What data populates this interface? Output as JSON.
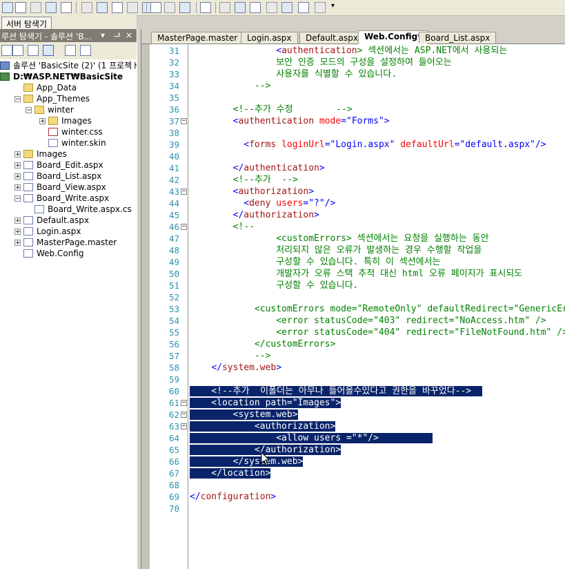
{
  "toolbar": {
    "icons": [
      "solution-explorer-icon",
      "properties-icon",
      "open-icon",
      "save-icon",
      "save-all-icon",
      "cut-icon",
      "copy-icon",
      "paste-icon",
      "undo-icon",
      "redo-icon",
      "indent-icon",
      "outdent-icon",
      "comment-icon",
      "uncomment-icon",
      "bookmark-icon",
      "prev-bookmark-icon",
      "next-bookmark-icon",
      "prev-bookmark-folder-icon",
      "next-bookmark-folder-icon",
      "clear-bookmarks-icon",
      "find-icon",
      "overflow-icon"
    ]
  },
  "server_tab": "서버 탐색기",
  "solution": {
    "title": "루션 탐색기 - 솔루션 'B...",
    "controls": [
      "▾",
      "ᅾ",
      "×"
    ],
    "tree": [
      {
        "label": "솔루션 'BasicSite (2)' (1 프로젝ト",
        "icon": "solution-icon",
        "level": 0
      },
      {
        "label": "D:₩ASP.NET₩BasicSite",
        "icon": "project-icon",
        "level": 0,
        "bold": true
      },
      {
        "label": "App_Data",
        "icon": "folder-icon",
        "level": 1
      },
      {
        "label": "App_Themes",
        "icon": "folder-icon",
        "level": 1,
        "expander": "−"
      },
      {
        "label": "winter",
        "icon": "folder-icon",
        "level": 2,
        "expander": "−"
      },
      {
        "label": "Images",
        "icon": "folder-icon",
        "level": 3,
        "expander": "+"
      },
      {
        "label": "winter.css",
        "icon": "css-file-icon",
        "level": 3
      },
      {
        "label": "winter.skin",
        "icon": "skin-file-icon",
        "level": 3
      },
      {
        "label": "Images",
        "icon": "folder-icon",
        "level": 1,
        "expander": "+"
      },
      {
        "label": "Board_Edit.aspx",
        "icon": "aspx-file-icon",
        "level": 1,
        "expander": "+"
      },
      {
        "label": "Board_List.aspx",
        "icon": "aspx-file-icon",
        "level": 1,
        "expander": "+"
      },
      {
        "label": "Board_View.aspx",
        "icon": "aspx-file-icon",
        "level": 1,
        "expander": "+"
      },
      {
        "label": "Board_Write.aspx",
        "icon": "aspx-file-icon",
        "level": 1,
        "expander": "−"
      },
      {
        "label": "Board_Write.aspx.cs",
        "icon": "cs-file-icon",
        "level": 2
      },
      {
        "label": "Default.aspx",
        "icon": "aspx-file-icon",
        "level": 1,
        "expander": "+"
      },
      {
        "label": "Login.aspx",
        "icon": "aspx-file-icon",
        "level": 1,
        "expander": "+"
      },
      {
        "label": "MasterPage.master",
        "icon": "master-file-icon",
        "level": 1,
        "expander": "+"
      },
      {
        "label": "Web.Config",
        "icon": "config-file-icon",
        "level": 1
      }
    ]
  },
  "tabs": [
    {
      "label": "MasterPage.master",
      "active": false
    },
    {
      "label": "Login.aspx",
      "active": false
    },
    {
      "label": "Default.aspx",
      "active": false
    },
    {
      "label": "Web.Config*",
      "active": true
    },
    {
      "label": "Board_List.aspx",
      "active": false
    }
  ],
  "editor": {
    "selection_color": "#0a246a",
    "fold_markers": {
      "37": "−",
      "43": "−",
      "46": "−",
      "61": "−",
      "62": "−",
      "63": "−"
    },
    "lines": [
      {
        "n": 31,
        "segs": [
          [
            "                ",
            ""
          ],
          [
            "<",
            "blue"
          ],
          [
            "authentication",
            "mar"
          ],
          [
            "> 섹션에서는 ASP.NET에서 사용되는",
            "green"
          ]
        ]
      },
      {
        "n": 32,
        "segs": [
          [
            "                보안 인증 모드의 구성을 설정하여 들어오는",
            "green"
          ]
        ]
      },
      {
        "n": 33,
        "segs": [
          [
            "                사용자를 식별할 수 있습니다.",
            "green"
          ]
        ]
      },
      {
        "n": 34,
        "segs": [
          [
            "            -->",
            "green"
          ]
        ]
      },
      {
        "n": 35,
        "segs": []
      },
      {
        "n": 36,
        "segs": [
          [
            "        ",
            ""
          ],
          [
            "<!--추가 수정        -->",
            "green"
          ]
        ]
      },
      {
        "n": 37,
        "segs": [
          [
            "        ",
            ""
          ],
          [
            "<",
            "blue"
          ],
          [
            "authentication",
            "mar"
          ],
          [
            " ",
            ""
          ],
          [
            "mode",
            "red"
          ],
          [
            "=\"",
            "blue"
          ],
          [
            "Forms",
            "blue"
          ],
          [
            "\">",
            "blue"
          ]
        ]
      },
      {
        "n": 38,
        "segs": []
      },
      {
        "n": 39,
        "segs": [
          [
            "          ",
            ""
          ],
          [
            "<",
            "blue"
          ],
          [
            "forms",
            "mar"
          ],
          [
            " ",
            ""
          ],
          [
            "loginUrl",
            "red"
          ],
          [
            "=\"Login.aspx\"",
            "blue"
          ],
          [
            " ",
            ""
          ],
          [
            "defaultUrl",
            "red"
          ],
          [
            "=\"default.aspx\"/>",
            "blue"
          ]
        ]
      },
      {
        "n": 40,
        "segs": []
      },
      {
        "n": 41,
        "segs": [
          [
            "        ",
            ""
          ],
          [
            "</",
            "blue"
          ],
          [
            "authentication",
            "mar"
          ],
          [
            ">",
            "blue"
          ]
        ]
      },
      {
        "n": 42,
        "segs": [
          [
            "        ",
            ""
          ],
          [
            "<!--추가  -->",
            "green"
          ]
        ]
      },
      {
        "n": 43,
        "segs": [
          [
            "        ",
            ""
          ],
          [
            "<",
            "blue"
          ],
          [
            "authorization",
            "mar"
          ],
          [
            ">",
            "blue"
          ]
        ]
      },
      {
        "n": 44,
        "segs": [
          [
            "          ",
            ""
          ],
          [
            "<",
            "blue"
          ],
          [
            "deny",
            "mar"
          ],
          [
            " ",
            ""
          ],
          [
            "users",
            "red"
          ],
          [
            "=\"?\"/>",
            "blue"
          ]
        ]
      },
      {
        "n": 45,
        "segs": [
          [
            "        ",
            ""
          ],
          [
            "</",
            "blue"
          ],
          [
            "authorization",
            "mar"
          ],
          [
            ">",
            "blue"
          ]
        ]
      },
      {
        "n": 46,
        "segs": [
          [
            "        ",
            ""
          ],
          [
            "<!--",
            "green"
          ]
        ]
      },
      {
        "n": 47,
        "segs": [
          [
            "                ",
            ""
          ],
          [
            "<customErrors> 섹션에서는 요청을 실행하는 동안",
            "green"
          ]
        ]
      },
      {
        "n": 48,
        "segs": [
          [
            "                처리되지 않은 오류가 발생하는 경우 수행할 작업을",
            "green"
          ]
        ]
      },
      {
        "n": 49,
        "segs": [
          [
            "                구성할 수 있습니다. 특히 이 섹션에서는",
            "green"
          ]
        ]
      },
      {
        "n": 50,
        "segs": [
          [
            "                개발자가 오류 스택 추적 대신 html 오류 페이지가 표시되도",
            "green"
          ]
        ]
      },
      {
        "n": 51,
        "segs": [
          [
            "                구성할 수 있습니다.",
            "green"
          ]
        ]
      },
      {
        "n": 52,
        "segs": []
      },
      {
        "n": 53,
        "segs": [
          [
            "            <customErrors mode=\"RemoteOnly\" defaultRedirect=\"GenericErro",
            "green"
          ]
        ]
      },
      {
        "n": 54,
        "segs": [
          [
            "                <error statusCode=\"403\" redirect=\"NoAccess.htm\" />",
            "green"
          ]
        ]
      },
      {
        "n": 55,
        "segs": [
          [
            "                <error statusCode=\"404\" redirect=\"FileNotFound.htm\" />",
            "green"
          ]
        ]
      },
      {
        "n": 56,
        "segs": [
          [
            "            </customErrors>",
            "green"
          ]
        ]
      },
      {
        "n": 57,
        "segs": [
          [
            "            -->",
            "green"
          ]
        ]
      },
      {
        "n": 58,
        "segs": [
          [
            "    ",
            ""
          ],
          [
            "</",
            "blue"
          ],
          [
            "system.web",
            "mar"
          ],
          [
            ">",
            "blue"
          ]
        ]
      },
      {
        "n": 59,
        "segs": []
      },
      {
        "n": 60,
        "sel": true,
        "segs": [
          [
            "    <!--추가  이폴더는 아무나 들어올수있다고 권한을 바꾸었다-->  ",
            "sel"
          ]
        ]
      },
      {
        "n": 61,
        "sel": true,
        "segs": [
          [
            "    <location path=\"Images\">",
            "sel"
          ]
        ]
      },
      {
        "n": 62,
        "sel": true,
        "segs": [
          [
            "        <system.web>",
            "sel"
          ]
        ]
      },
      {
        "n": 63,
        "sel": true,
        "segs": [
          [
            "            <authorization>",
            "sel"
          ]
        ]
      },
      {
        "n": 64,
        "sel": true,
        "segs": [
          [
            "                <allow users =\"*\"/>          ",
            "sel"
          ]
        ]
      },
      {
        "n": 65,
        "sel": true,
        "segs": [
          [
            "            </authorization>",
            "sel"
          ]
        ]
      },
      {
        "n": 66,
        "sel": true,
        "segs": [
          [
            "        </system.web>",
            "sel"
          ]
        ]
      },
      {
        "n": 67,
        "sel": true,
        "segs": [
          [
            "    </location>",
            "sel"
          ]
        ]
      },
      {
        "n": 68,
        "segs": []
      },
      {
        "n": 69,
        "segs": [
          [
            "</",
            "blue"
          ],
          [
            "configuration",
            "mar"
          ],
          [
            ">",
            "blue"
          ]
        ]
      },
      {
        "n": 70,
        "segs": []
      }
    ]
  }
}
